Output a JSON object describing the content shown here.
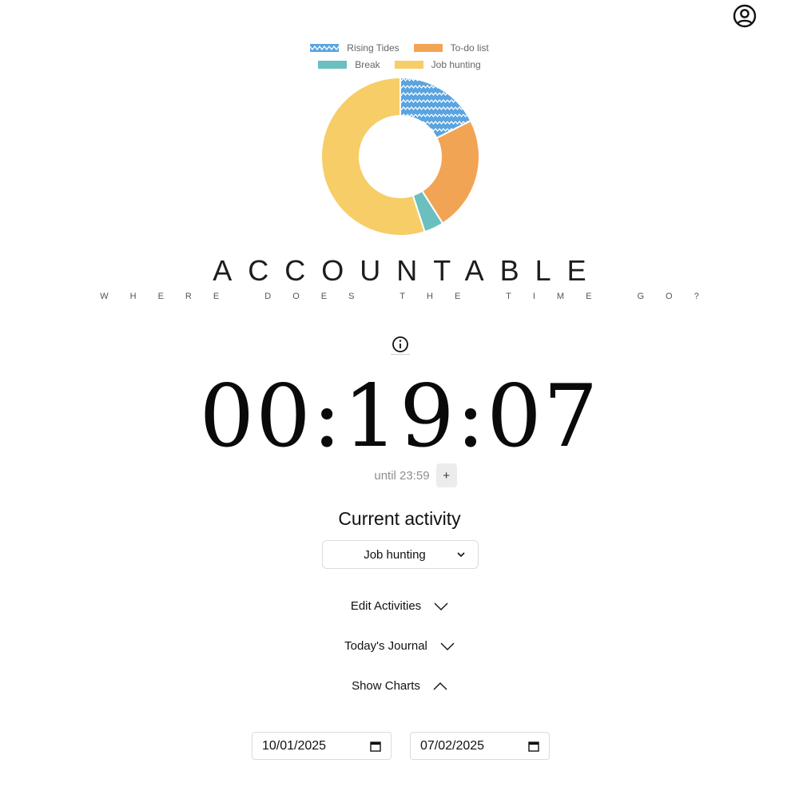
{
  "header": {
    "profile_icon": "user-circle-icon"
  },
  "chart_data": {
    "type": "pie",
    "variant": "doughnut",
    "legend_position": "top",
    "categories": [
      "Rising Tides",
      "To-do list",
      "Break",
      "Job hunting"
    ],
    "values": [
      17.5,
      23.5,
      4,
      55
    ],
    "colors": [
      "#5aa4e0",
      "#f2a455",
      "#6bbfbf",
      "#f7cd68"
    ],
    "patterns": [
      "zigzag",
      "solid",
      "solid",
      "solid"
    ]
  },
  "branding": {
    "title": "ACCOUNTABLE",
    "tagline": "WHERE DOES THE TIME GO?"
  },
  "info_icon": "info-circle-icon",
  "timer": {
    "display": "00:19:07",
    "until_label": "until 23:59",
    "add_label": "+"
  },
  "activity": {
    "heading": "Current activity",
    "selected": "Job hunting"
  },
  "sections": {
    "edit_activities": "Edit Activities",
    "todays_journal": "Today's Journal",
    "show_charts": "Show Charts"
  },
  "date_range": {
    "start": "10/01/2025",
    "end": "07/02/2025"
  }
}
